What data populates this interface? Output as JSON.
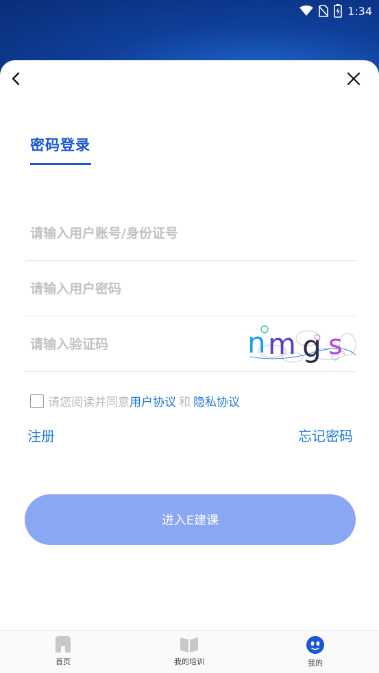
{
  "status_bar": {
    "time": "1:34"
  },
  "login": {
    "tab_label": "密码登录",
    "account_placeholder": "请输入用户账号/身份证号",
    "password_placeholder": "请输入用户密码",
    "captcha_placeholder": "请输入验证码",
    "captcha_text": "nmgs",
    "agree_prefix": "请您阅读并同意",
    "user_agreement": "用户协议",
    "and_text": "和",
    "privacy_agreement": "隐私协议",
    "register": "注册",
    "forgot_password": "忘记密码",
    "submit": "进入E建课"
  },
  "bottom_nav": [
    {
      "label": "首页",
      "icon": "home-icon"
    },
    {
      "label": "我的培训",
      "icon": "book-icon"
    },
    {
      "label": "我的",
      "icon": "profile-face-icon"
    }
  ],
  "colors": {
    "primary": "#1a56d6",
    "link": "#1a77d6",
    "button": "#8aa7f3",
    "header": "#0f3f9a"
  }
}
